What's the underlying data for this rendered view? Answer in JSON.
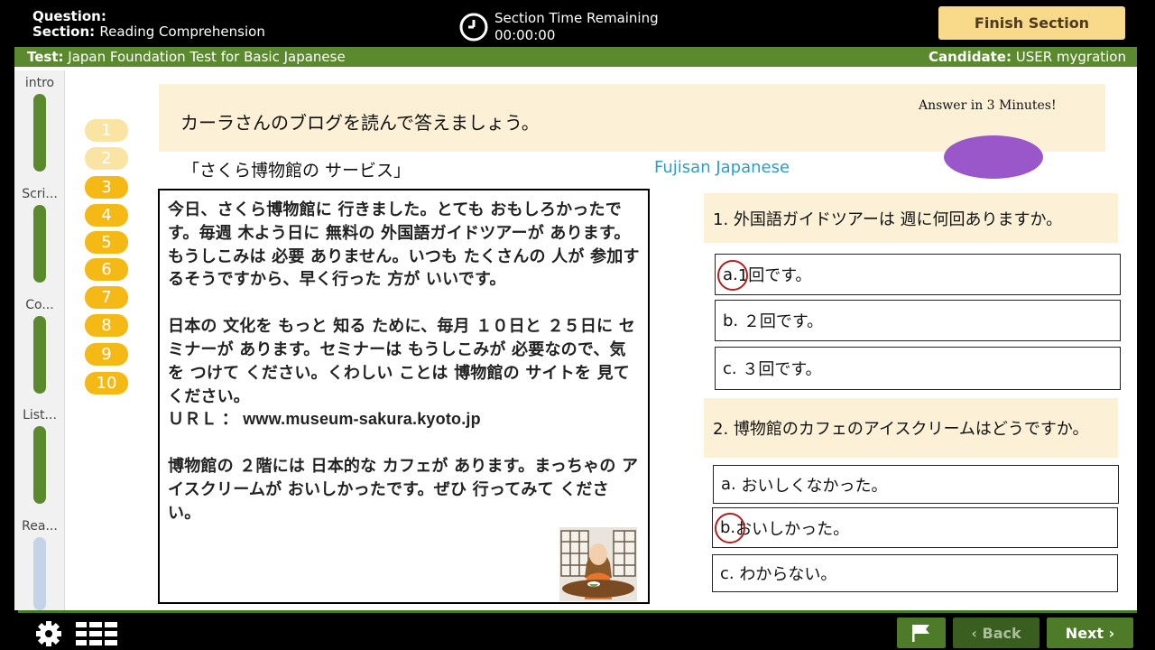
{
  "header": {
    "question_label": "Question:",
    "section_label": "Section:",
    "section_value": "Reading Comprehension",
    "timer_label": "Section Time Remaining",
    "timer_value": "00:00:00",
    "finish_button": "Finish Section"
  },
  "status_bar": {
    "test_label": "Test:",
    "test_value": "Japan Foundation Test for Basic Japanese",
    "candidate_label": "Candidate:",
    "candidate_value": "USER mygration"
  },
  "sections": [
    {
      "label": "intro",
      "status": "complete"
    },
    {
      "label": "Scri...",
      "status": "complete"
    },
    {
      "label": "Co...",
      "status": "complete"
    },
    {
      "label": "List...",
      "status": "complete"
    },
    {
      "label": "Rea...",
      "status": "current"
    }
  ],
  "question_numbers": [
    "1",
    "2",
    "3",
    "4",
    "5",
    "6",
    "7",
    "8",
    "9",
    "10"
  ],
  "instruction": {
    "text": "カーラさんのブログを読んで答えましょう。",
    "note": "Answer in 3 Minutes!"
  },
  "passage": {
    "title": "「さくら博物館の サービス」",
    "brand": "Fujisan Japanese",
    "para1": "今日、さくら博物館に 行きました。とても おもしろかったです。毎週 木よう日に 無料の 外国語ガイドツアーが あります。もうしこみは 必要 ありません。いつも たくさんの 人が 参加するそうですから、早く行った 方が いいです。",
    "para2": "日本の 文化を もっと 知る ために、毎月 １０日と ２５日に セミナーが あります。セミナーは もうしこみが 必要なので、気を つけて ください。くわしい ことは 博物館の サイトを 見て ください。",
    "url_line": "ＵＲＬ ： www.museum-sakura.kyoto.jp",
    "para3": "博物館の ２階には 日本的な カフェが あります。まっちゃの アイスクリームが おいしかったです。ぜひ 行ってみて ください。"
  },
  "questions": [
    {
      "prompt": "1. 外国語ガイドツアーは 週に何回ありますか。",
      "options": [
        {
          "letter": "a.",
          "text": "1回です。",
          "selected": true
        },
        {
          "letter": "b.",
          "text": "２回です。",
          "selected": false
        },
        {
          "letter": "c.",
          "text": "３回です。",
          "selected": false
        }
      ]
    },
    {
      "prompt": "2. 博物館のカフェのアイスクリームはどうですか。",
      "options": [
        {
          "letter": "a.",
          "text": "おいしくなかった。",
          "selected": false
        },
        {
          "letter": "b.",
          "text": "おいしかった。",
          "selected": true
        },
        {
          "letter": "c.",
          "text": "わからない。",
          "selected": false
        }
      ]
    }
  ],
  "footer": {
    "settings_icon": "gear-icon",
    "grid_icon": "grid-icon",
    "flag_icon": "flag-icon",
    "back_label": "Back",
    "next_label": "Next"
  },
  "colors": {
    "green": "#5b8a2e",
    "gold": "#f5b915",
    "cream": "#fcf1d6",
    "finish": "#f9d98a",
    "accent_blue": "#2aa0c8",
    "purple": "#9a57c9"
  }
}
